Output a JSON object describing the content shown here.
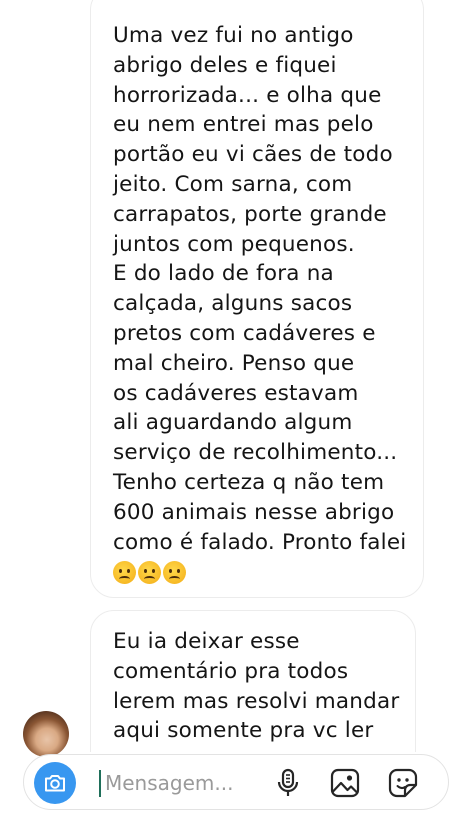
{
  "thread": {
    "messages": [
      {
        "lines": [
          "Uma vez fui no antigo",
          "abrigo deles e fiquei",
          "horrorizada... e olha que",
          "eu nem entrei mas pelo",
          "portão eu vi cães de todo",
          "jeito. Com sarna, com",
          "carrapatos, porte grande",
          "juntos com pequenos.",
          "E do lado de fora na",
          "calçada, alguns sacos",
          "pretos com cadáveres e",
          "mal cheiro. Penso que",
          "os cadáveres estavam",
          "ali aguardando algum",
          "serviço de recolhimento...",
          "Tenho certeza q não tem",
          "600 animais nesse abrigo",
          "como é falado. Pronto falei"
        ],
        "emojis": [
          "frowning-face",
          "frowning-face",
          "frowning-face"
        ]
      },
      {
        "lines": [
          "Eu ia deixar esse",
          "comentário pra todos",
          "lerem mas resolvi mandar",
          "aqui somente pra vc ler"
        ]
      }
    ]
  },
  "composer": {
    "placeholder": "Mensagem...",
    "value": "",
    "camera_icon": "camera-icon",
    "mic_icon": "microphone-icon",
    "gallery_icon": "gallery-icon",
    "sticker_icon": "sticker-icon",
    "accent_color": "#3897f0"
  }
}
